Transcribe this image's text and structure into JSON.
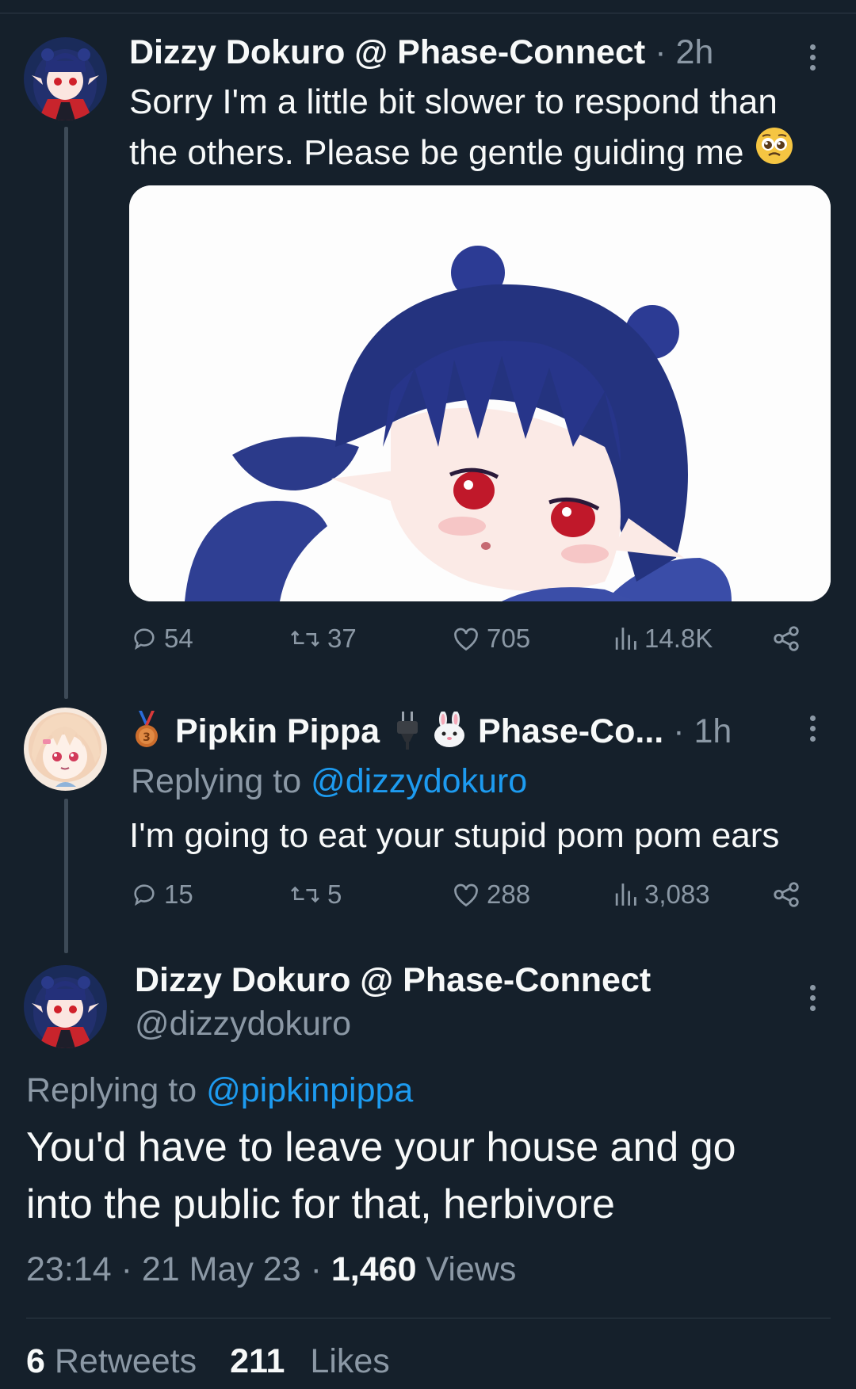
{
  "tweet1": {
    "display_name": "Dizzy Dokuro @ Phase-Connect",
    "time": "· 2h",
    "text_line1": "Sorry I'm a little bit slower to respond than",
    "text_line2": "the others. Please be gentle guiding me",
    "emoji": "pleading-face",
    "actions": {
      "replies": "54",
      "retweets": "37",
      "likes": "705",
      "views": "14.8K"
    }
  },
  "tweet2": {
    "badge_emoji": "third-place-medal",
    "display_name": "Pipkin Pippa",
    "plug_emoji": "electric-plug",
    "rabbit_emoji": "rabbit-face",
    "name_suffix": "Phase-Co...",
    "time": "· 1h",
    "replying_prefix": "Replying to",
    "replying_handle": "@dizzydokuro",
    "text": "I'm going to eat your stupid pom pom ears",
    "actions": {
      "replies": "15",
      "retweets": "5",
      "likes": "288",
      "views": "3,083"
    }
  },
  "tweet3": {
    "display_name": "Dizzy Dokuro @ Phase-Connect",
    "handle": "@dizzydokuro",
    "replying_prefix": "Replying to",
    "replying_handle": "@pipkinpippa",
    "text_line1": "You'd have to leave your house and go",
    "text_line2": "into the public for that, herbivore",
    "time": "23:14",
    "date": "21 May 23",
    "views_count": "1,460",
    "views_label": "Views",
    "retweets_count": "6",
    "retweets_label": "Retweets",
    "likes_count": "211",
    "likes_label": "Likes"
  },
  "colors": {
    "background": "#15202b",
    "text": "#f7f9f9",
    "muted": "#8b98a5",
    "link": "#1d9bf0",
    "thread": "#3d4a57"
  }
}
